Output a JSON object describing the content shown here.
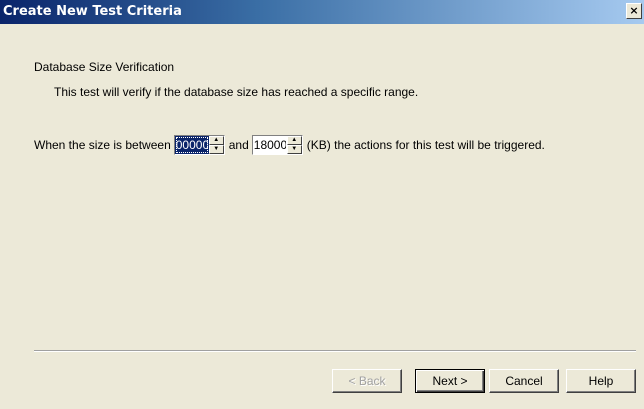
{
  "window": {
    "title": "Create New Test Criteria",
    "close_glyph": "×"
  },
  "content": {
    "heading": "Database Size Verification",
    "description": "This test will verify if the database size has reached a specific range."
  },
  "criteria": {
    "prefix": "When the size is between",
    "min_value": "00000",
    "conjunction": "and",
    "max_value": "18000",
    "suffix": "(KB) the actions for this test will be triggered.",
    "spin_up_glyph": "▲",
    "spin_down_glyph": "▼"
  },
  "buttons": {
    "back": "< Back",
    "next": "Next >",
    "cancel": "Cancel",
    "help": "Help"
  }
}
